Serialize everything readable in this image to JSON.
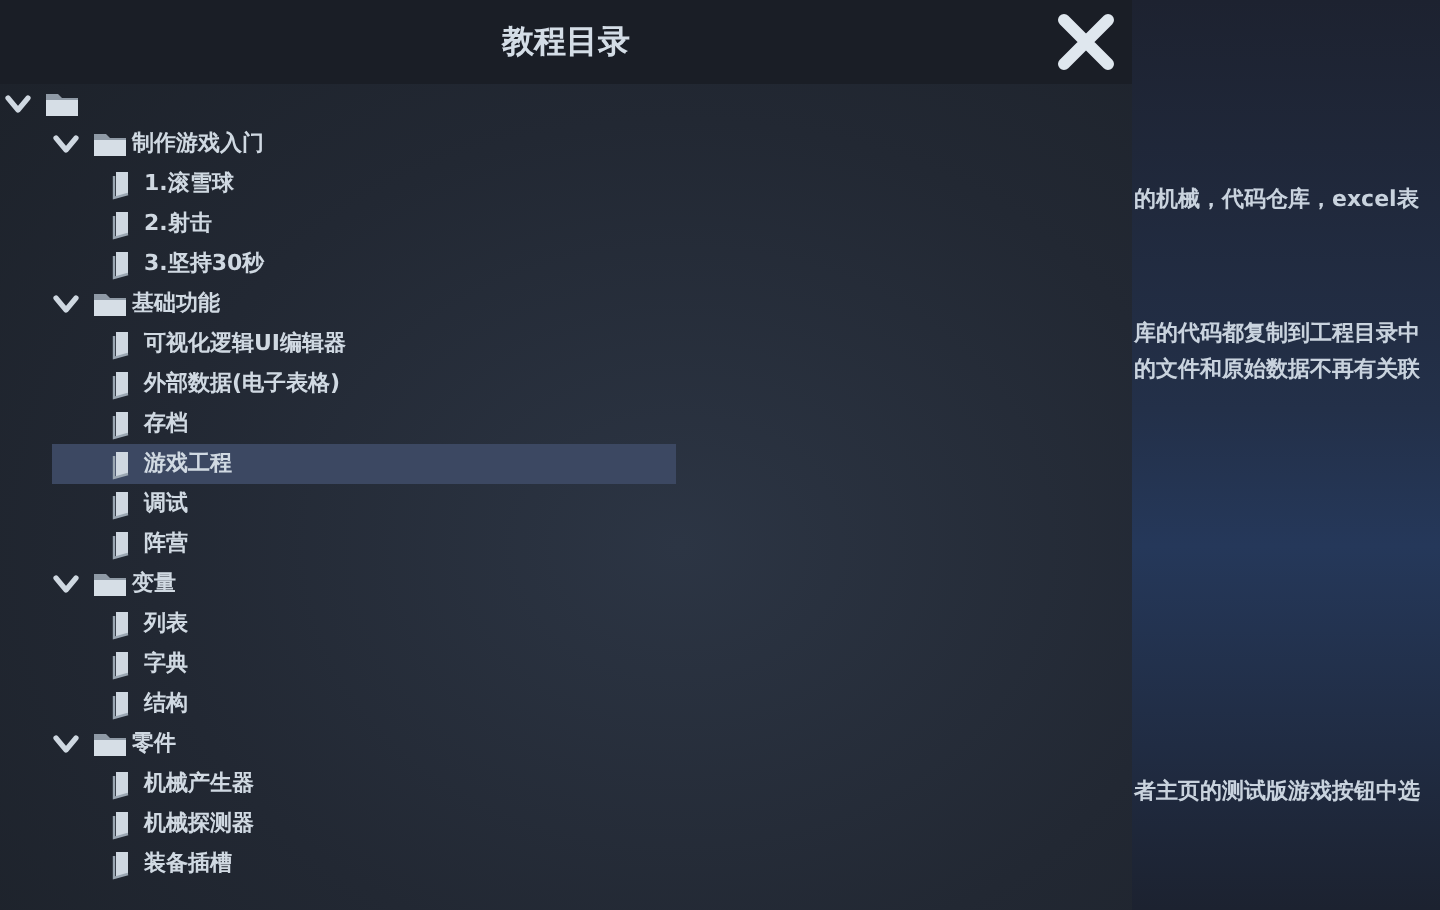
{
  "panel": {
    "title": "教程目录"
  },
  "tree": [
    {
      "expanded": true,
      "selected": false,
      "children": [
        {
          "label": "制作游戏入门",
          "expanded": true,
          "selected": false,
          "children": [
            {
              "label": "1.滚雪球",
              "selected": false
            },
            {
              "label": "2.射击",
              "selected": false
            },
            {
              "label": "3.坚持30秒",
              "selected": false
            }
          ]
        },
        {
          "label": "基础功能",
          "expanded": true,
          "selected": false,
          "children": [
            {
              "label": "可视化逻辑UI编辑器",
              "selected": false
            },
            {
              "label": "外部数据(电子表格)",
              "selected": false
            },
            {
              "label": "存档",
              "selected": false
            },
            {
              "label": "游戏工程",
              "selected": true
            },
            {
              "label": "调试",
              "selected": false
            },
            {
              "label": "阵营",
              "selected": false
            }
          ]
        },
        {
          "label": "变量",
          "expanded": true,
          "selected": false,
          "children": [
            {
              "label": "列表",
              "selected": false
            },
            {
              "label": "字典",
              "selected": false
            },
            {
              "label": "结构",
              "selected": false
            }
          ]
        },
        {
          "label": "零件",
          "expanded": true,
          "selected": false,
          "children": [
            {
              "label": "机械产生器",
              "selected": false
            },
            {
              "label": "机械探测器",
              "selected": false
            },
            {
              "label": "装备插槽",
              "selected": false
            }
          ]
        }
      ]
    }
  ],
  "content_lines": [
    "的机械，代码仓库，excel表",
    "库的代码都复制到工程目录中",
    "的文件和原始数据不再有关联",
    "者主页的测试版游戏按钮中选"
  ]
}
